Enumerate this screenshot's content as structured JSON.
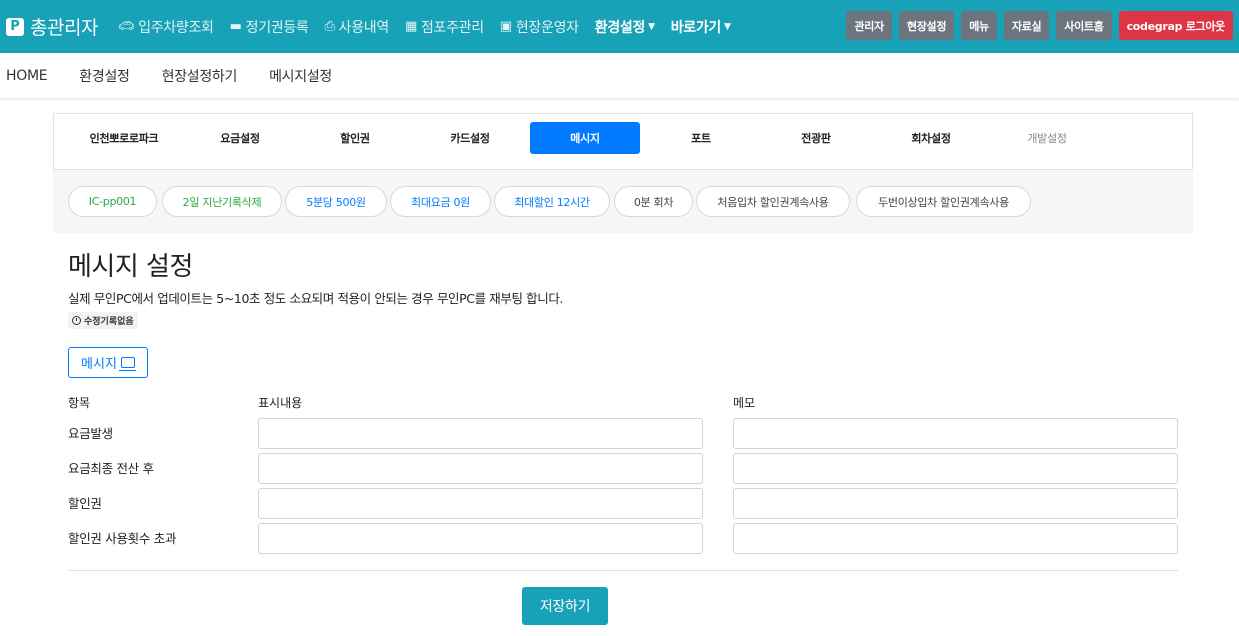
{
  "brand": {
    "logo_letter": "P",
    "title": "총관리자"
  },
  "nav": {
    "links": [
      {
        "label": "입주차량조회",
        "icon": "car-icon"
      },
      {
        "label": "정기권등록",
        "icon": "card-icon"
      },
      {
        "label": "사용내역",
        "icon": "print-icon"
      },
      {
        "label": "점포주관리",
        "icon": "store-icon"
      },
      {
        "label": "현장운영자",
        "icon": "users-icon"
      },
      {
        "label": "환경설정",
        "icon": ""
      },
      {
        "label": "바로가기",
        "icon": ""
      }
    ],
    "buttons": [
      "관리자",
      "현장설정",
      "메뉴",
      "자료실",
      "사이트홈",
      "codegrap 로그아웃"
    ],
    "accent_color": "#17a2b8",
    "logout_color": "#dc3545"
  },
  "breadcrumb": [
    "HOME",
    "환경설정",
    "현장설정하기",
    "메시지설정"
  ],
  "tabs": [
    "인천뽀로로파크",
    "요금설정",
    "할인권",
    "카드설정",
    "메시지",
    "포트",
    "전광판",
    "회차설정",
    "개발설정"
  ],
  "active_tab": "메시지",
  "chips": [
    {
      "label": "IC-pp001",
      "color": "green"
    },
    {
      "label": "2일 지난기록삭제",
      "color": "green"
    },
    {
      "label": "5분당 500원",
      "color": "blue"
    },
    {
      "label": "최대요금 0원",
      "color": "blue"
    },
    {
      "label": "최대할인 12시간",
      "color": "blue"
    },
    {
      "label": "0분 회차",
      "color": "gray"
    },
    {
      "label": "처음입차 할인권계속사용",
      "color": "gray"
    },
    {
      "label": "두번이상입차 할인권계속사용",
      "color": "gray"
    }
  ],
  "page": {
    "title": "메시지 설정",
    "description": "실제 무인PC에서 업데이트는 5~10초 정도 소요되며 적용이 안되는 경우 무인PC를 재부팅 합니다.",
    "history_badge": "수정기록없음",
    "message_button": "메시지"
  },
  "form": {
    "headers": {
      "item": "항목",
      "display": "표시내용",
      "memo": "메모"
    },
    "rows": [
      {
        "label": "요금발생",
        "display": "",
        "memo": ""
      },
      {
        "label": "요금최종 전산 후",
        "display": "",
        "memo": ""
      },
      {
        "label": "할인권",
        "display": "",
        "memo": ""
      },
      {
        "label": "할인권 사용횟수 초과",
        "display": "",
        "memo": ""
      }
    ],
    "save_label": "저장하기"
  }
}
